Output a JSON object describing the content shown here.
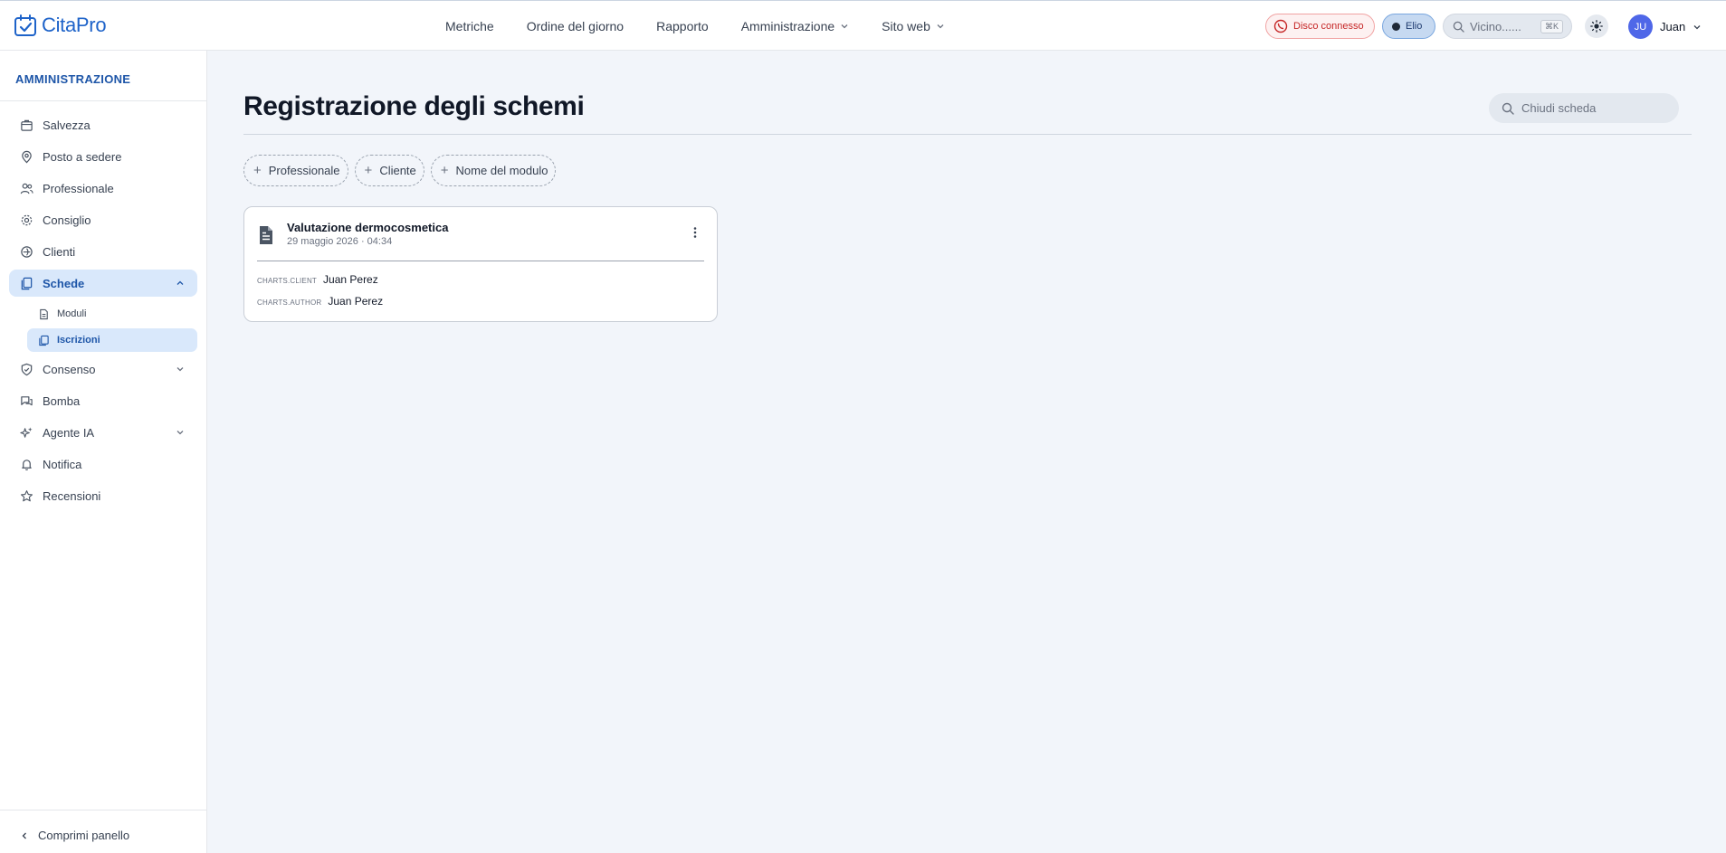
{
  "app": {
    "logo_text": "CitaPro",
    "brand_color": "#1e63c9"
  },
  "nav": {
    "items": [
      {
        "label": "Metriche"
      },
      {
        "label": "Ordine del giorno"
      },
      {
        "label": "Rapporto"
      },
      {
        "label": "Amministrazione"
      },
      {
        "label": "Sito web"
      }
    ]
  },
  "toolbar": {
    "disc_status": "Disco connesso",
    "agent_label": "Elio",
    "search_placeholder": "Vicino......",
    "search_shortcut": "⌘K",
    "user_initials": "JU",
    "user_name": "Juan"
  },
  "sidebar": {
    "title": "AMMINISTRAZIONE",
    "items": [
      {
        "label": "Salvezza",
        "icon": "building-icon"
      },
      {
        "label": "Posto a sedere",
        "icon": "map-pin-icon"
      },
      {
        "label": "Professionale",
        "icon": "users-icon"
      },
      {
        "label": "Consiglio",
        "icon": "services-icon"
      },
      {
        "label": "Clienti",
        "icon": "clients-icon"
      },
      {
        "label": "Schede",
        "icon": "charts-icon"
      },
      {
        "label": "Moduli",
        "icon": "form-icon"
      },
      {
        "label": "Iscrizioni",
        "icon": "records-icon"
      },
      {
        "label": "Consenso",
        "icon": "shield-check-icon"
      },
      {
        "label": "Bomba",
        "icon": "chat-icon"
      },
      {
        "label": "Agente IA",
        "icon": "sparkles-icon"
      },
      {
        "label": "Notifica",
        "icon": "bell-icon"
      },
      {
        "label": "Recensioni",
        "icon": "star-icon"
      }
    ],
    "collapse_label": "Comprimi panello"
  },
  "main": {
    "title": "Registrazione degli schemi",
    "search_placeholder": "Chiudi scheda",
    "filters": [
      {
        "label": "Professionale"
      },
      {
        "label": "Cliente"
      },
      {
        "label": "Nome del modulo"
      }
    ],
    "records": [
      {
        "title": "Valutazione dermocosmetica",
        "date": "29 maggio 2026 · 04:34",
        "fields": [
          {
            "key": "CHARTS.CLIENT",
            "value": "Juan Perez"
          },
          {
            "key": "CHARTS.AUTHOR",
            "value": "Juan Perez"
          }
        ]
      }
    ]
  }
}
